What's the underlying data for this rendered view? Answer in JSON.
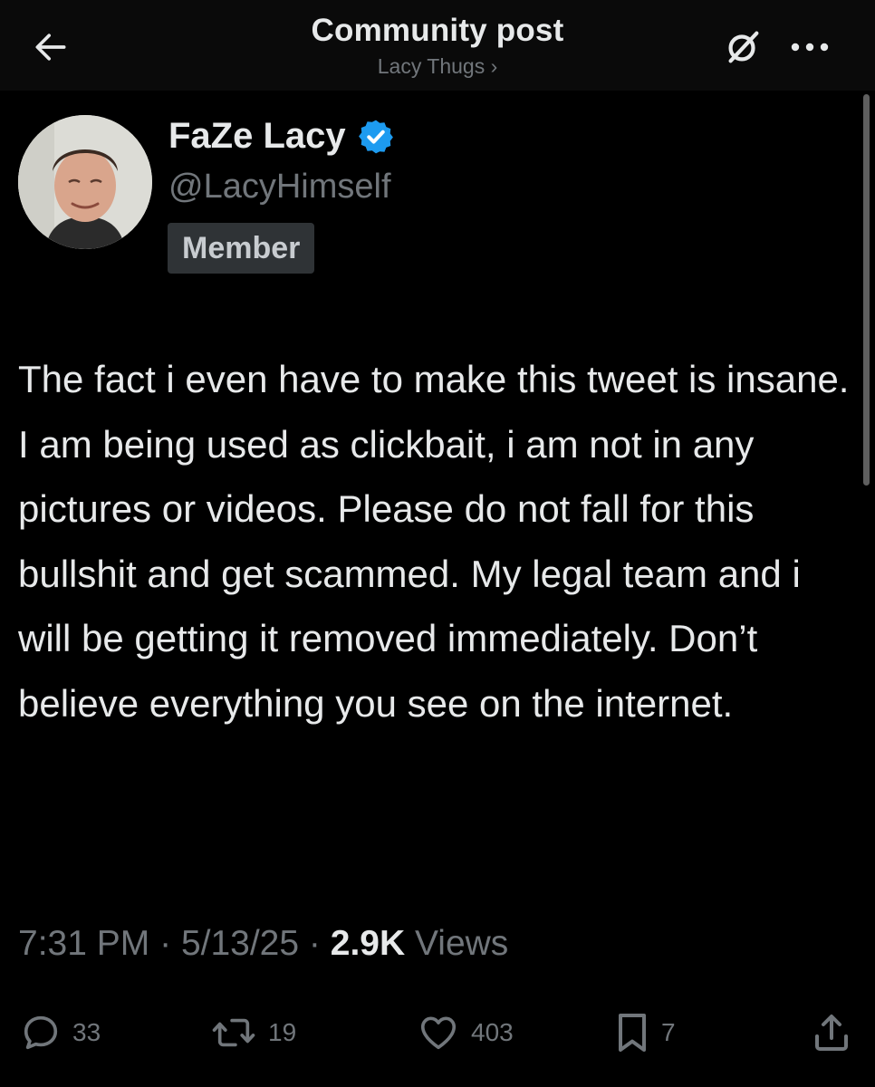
{
  "header": {
    "back_icon": "arrow-left-icon",
    "title": "Community post",
    "subtitle": "Lacy Thugs ›",
    "right_icons": [
      "no-symbol-icon",
      "more-dots-icon"
    ]
  },
  "post": {
    "author": {
      "display_name": "FaZe Lacy",
      "handle": "@LacyHimself",
      "verified_icon": "verified-badge-icon",
      "badge": "Member"
    },
    "text": "The fact i even have to make this tweet is insane. I am being used as clickbait, i am not in any pictures or videos. Please do not fall for this bullshit and get scammed. My legal team and i will be getting it removed immediately. Don’t believe everything you see on the internet.",
    "time": "7:31 PM",
    "separator": "·",
    "date": "5/13/25",
    "views_count": "2.9K",
    "views_label": "Views"
  },
  "actions": {
    "reply_count": "33",
    "repost_count": "19",
    "like_count": "403",
    "bookmark_count": "7"
  },
  "colors": {
    "background": "#000000",
    "text_primary": "#e7e9ea",
    "text_secondary": "#71767b",
    "verified_blue": "#1d9bf0",
    "badge_bg": "#2f3336"
  }
}
